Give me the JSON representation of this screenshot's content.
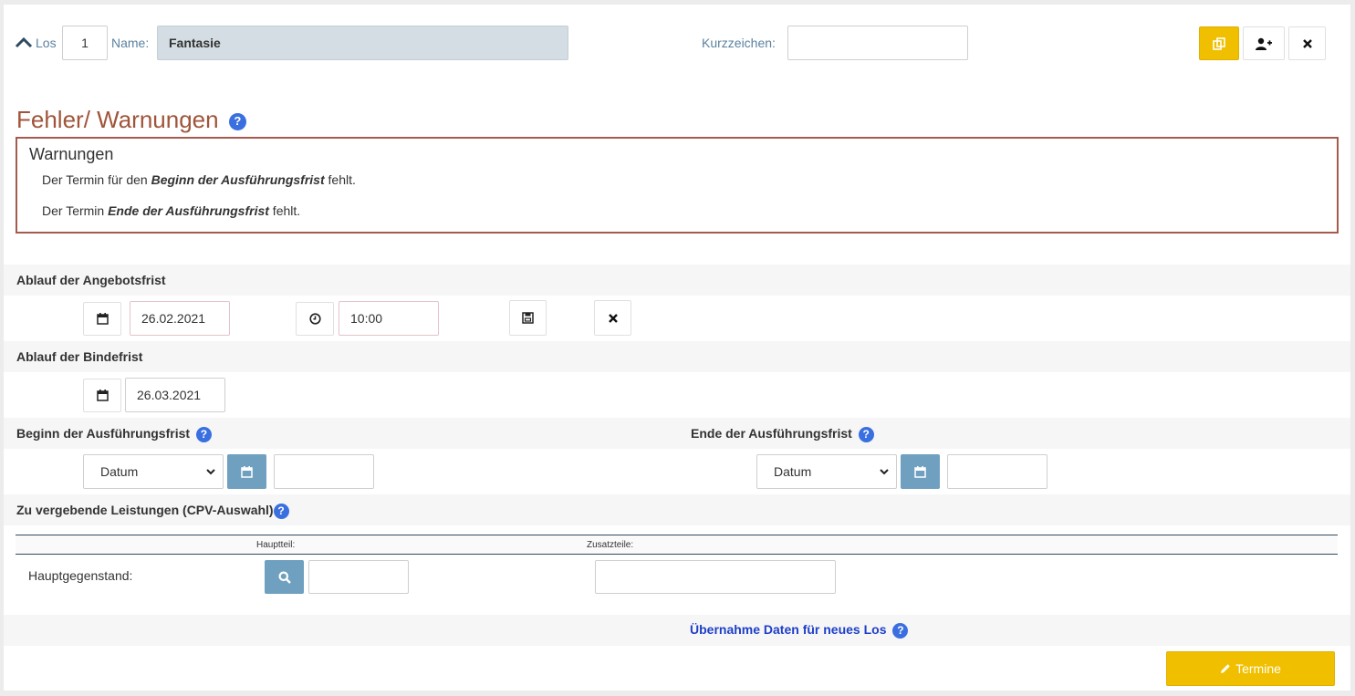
{
  "header": {
    "los_label": "Los",
    "los_value": "1",
    "name_label": "Name:",
    "name_value": "Fantasie",
    "kurz_label": "Kurzzeichen:",
    "kurz_value": ""
  },
  "errors": {
    "title": "Fehler/ Warnungen",
    "box_title": "Warnungen",
    "warning1": {
      "pre": "Der Termin für den ",
      "bold": "Beginn der Ausführungsfrist",
      "post": " fehlt."
    },
    "warning2": {
      "pre": "Der Termin ",
      "bold": "Ende der Ausführungsfrist",
      "post": " fehlt."
    }
  },
  "angebot": {
    "label": "Ablauf der Angebotsfrist",
    "date": "26.02.2021",
    "time": "10:00"
  },
  "binde": {
    "label": "Ablauf der Bindefrist",
    "date": "26.03.2021"
  },
  "ausf": {
    "begin_label": "Beginn der Ausführungsfrist",
    "begin_select": "Datum",
    "begin_value": "",
    "end_label": "Ende der Ausführungsfrist",
    "end_select": "Datum",
    "end_value": ""
  },
  "cpv": {
    "label": "Zu vergebende Leistungen (CPV-Auswahl)",
    "col_haupt": "Hauptteil:",
    "col_zusatz": "Zusatzteile:",
    "row_label": "Hauptgegenstand:",
    "haupt_value": "",
    "zusatz_value": ""
  },
  "uebernahme_link": "Übernahme Daten für neues Los",
  "termine_button": "Termine",
  "colors": {
    "accent_yellow": "#f0c000",
    "heading_brown": "#a0553a",
    "button_blue": "#6fa0c0",
    "help_blue": "#3a6fe0"
  }
}
